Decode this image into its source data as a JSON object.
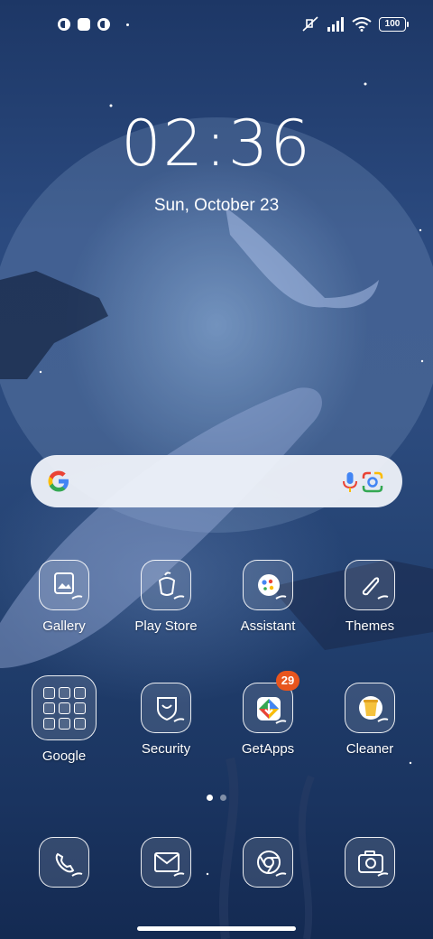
{
  "status_bar": {
    "left_icons": [
      "notification-icon",
      "square-notification-icon",
      "notification-icon",
      "dot-icon"
    ],
    "right_icons": [
      "mute-icon",
      "signal-icon",
      "wifi-icon"
    ],
    "battery": "100"
  },
  "lockscreen": {
    "time": "02:36",
    "date": "Sun, October 23"
  },
  "search_bar": {
    "icons": [
      "google-g-icon",
      "microphone-icon",
      "google-lens-icon"
    ]
  },
  "apps": [
    {
      "label": "Gallery",
      "icon": "gallery-icon"
    },
    {
      "label": "Play Store",
      "icon": "play-store-icon"
    },
    {
      "label": "Assistant",
      "icon": "assistant-icon"
    },
    {
      "label": "Themes",
      "icon": "themes-icon"
    },
    {
      "label": "Google",
      "icon": "folder-icon"
    },
    {
      "label": "Security",
      "icon": "security-icon"
    },
    {
      "label": "GetApps",
      "icon": "getapps-icon",
      "badge": "29"
    },
    {
      "label": "Cleaner",
      "icon": "cleaner-icon"
    }
  ],
  "dock": [
    {
      "icon": "phone-icon"
    },
    {
      "icon": "messages-icon"
    },
    {
      "icon": "chrome-icon"
    },
    {
      "icon": "camera-icon"
    }
  ],
  "pager": {
    "pages": 2,
    "active": 1
  },
  "colors": {
    "badge": "#e8551e",
    "wallpaper": "#2b4a7f"
  }
}
